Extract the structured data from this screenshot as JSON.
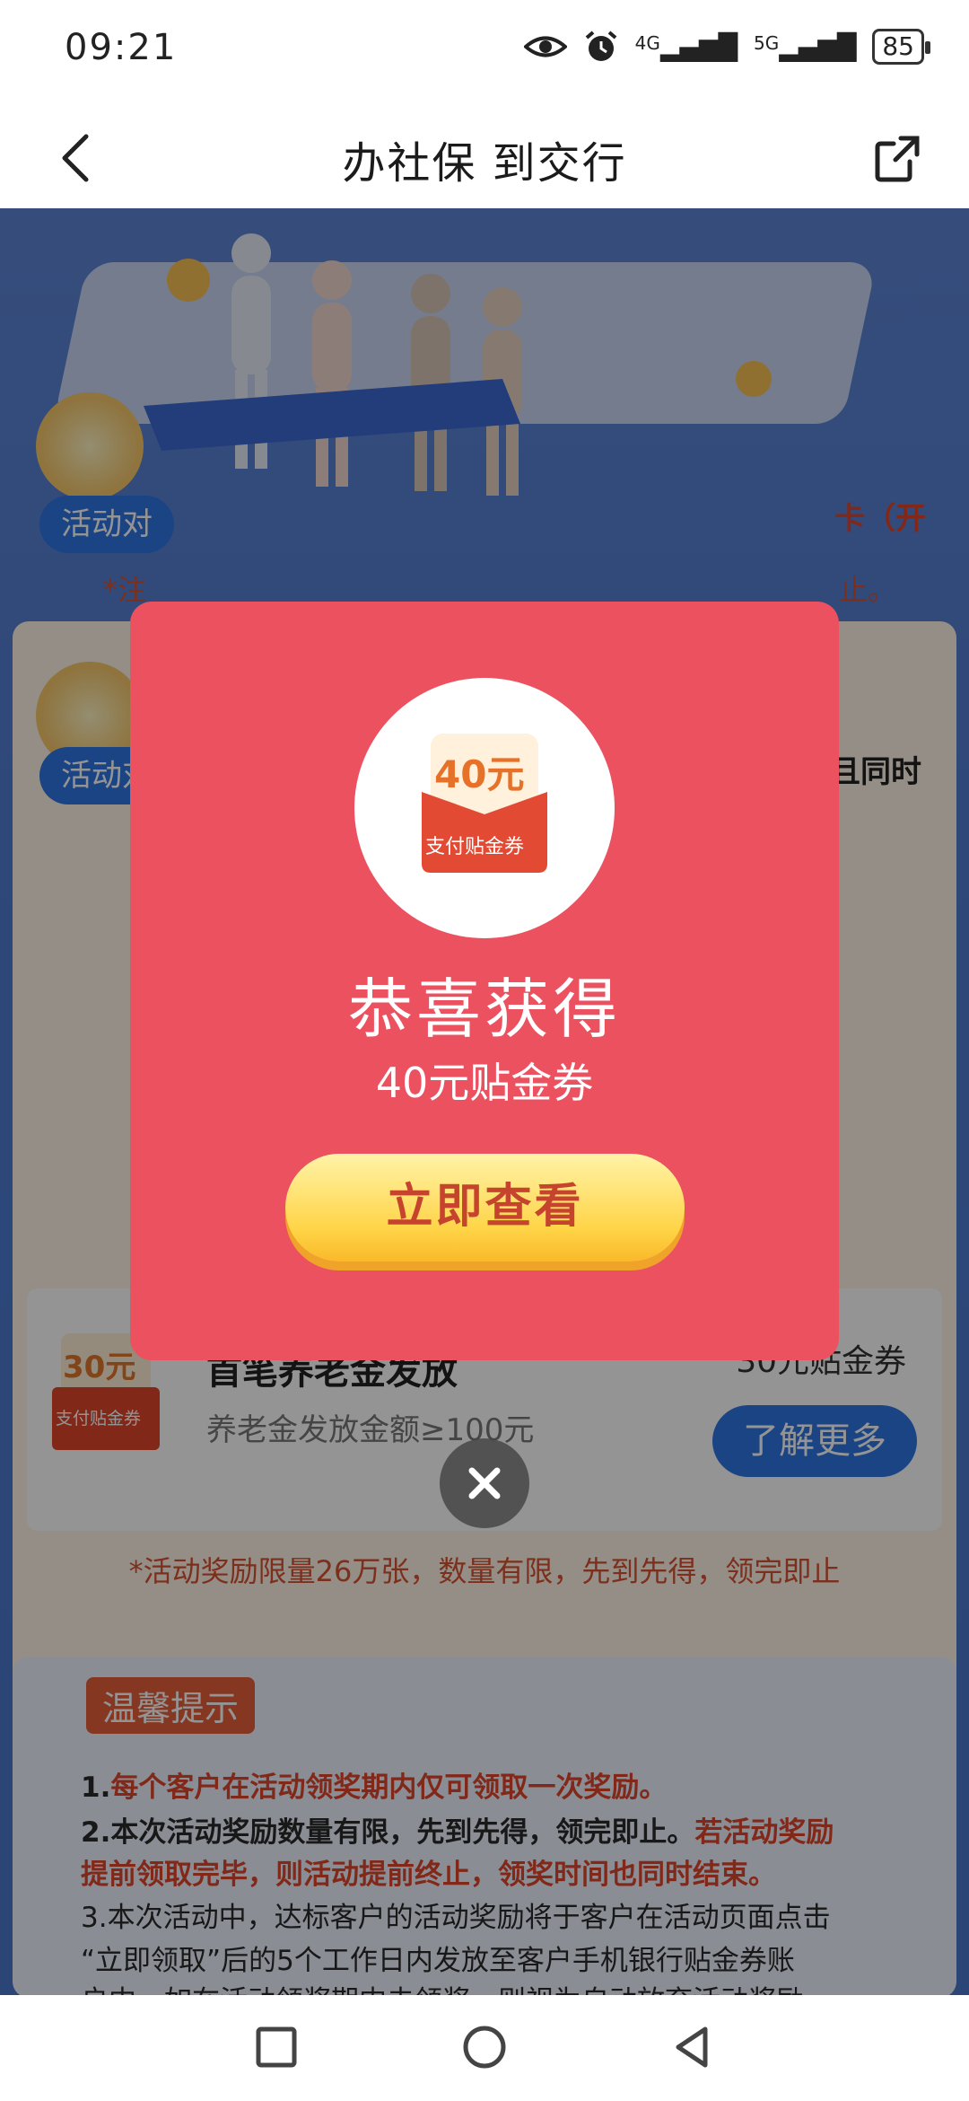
{
  "status_bar": {
    "time": "09:21",
    "signal_4g": "4G",
    "signal_5g": "5G",
    "battery": "85",
    "icons": [
      "eye-icon",
      "alarm-icon",
      "signal-4g-icon",
      "signal-5g-icon",
      "battery-icon"
    ]
  },
  "header": {
    "title": "办社保  到交行",
    "back_icon": "chevron-left-icon",
    "share_icon": "share-icon"
  },
  "background": {
    "card1_pill": "活动对",
    "card1_right_text": "卡（开",
    "card1_note_left": "*注",
    "card1_note_right": "止。",
    "card2_pill": "活动对",
    "card2_right_text": "且同时",
    "reward": {
      "coupon_amount": "30元",
      "coupon_label": "支付贴金券",
      "title": "首笔养老金发放",
      "subtitle": "养老金发放金额≥100元",
      "amount": "30元贴金券",
      "button": "了解更多"
    },
    "limit_note": "*活动奖励限量26万张，数量有限，先到先得，领完即止",
    "tips": {
      "title": "温馨提示",
      "line1_num": "1.",
      "line1": "每个客户在活动领奖期内仅可领取一次奖励。",
      "line2_num": "2.",
      "line2_a": "本次活动奖励数量有限，先到先得，领完即止。",
      "line2_b": "若活动奖励",
      "line3": "提前领取完毕，则活动提前终止，领奖时间也同时结束。",
      "line4": "3.本次活动中，达标客户的活动奖励将于客户在活动页面点击",
      "line5": "“立即领取”后的5个工作日内发放至客户手机银行贴金券账",
      "line6": "户中。如在活动领奖期内未领奖，则视为自动放弃活动奖励"
    }
  },
  "modal": {
    "coupon_amount": "40元",
    "coupon_label": "支付贴金券",
    "title": "恭喜获得",
    "subtitle": "40元贴金券",
    "button": "立即查看",
    "close_icon": "close-icon"
  },
  "nav_bar": {
    "icons": [
      "square-icon",
      "circle-icon",
      "triangle-back-icon"
    ]
  },
  "colors": {
    "modal_bg": "#ec5160",
    "button_yellow": "#ffd447",
    "button_text": "#c6432d",
    "page_blue": "#4f7bd1",
    "accent_red": "#e0462c"
  }
}
